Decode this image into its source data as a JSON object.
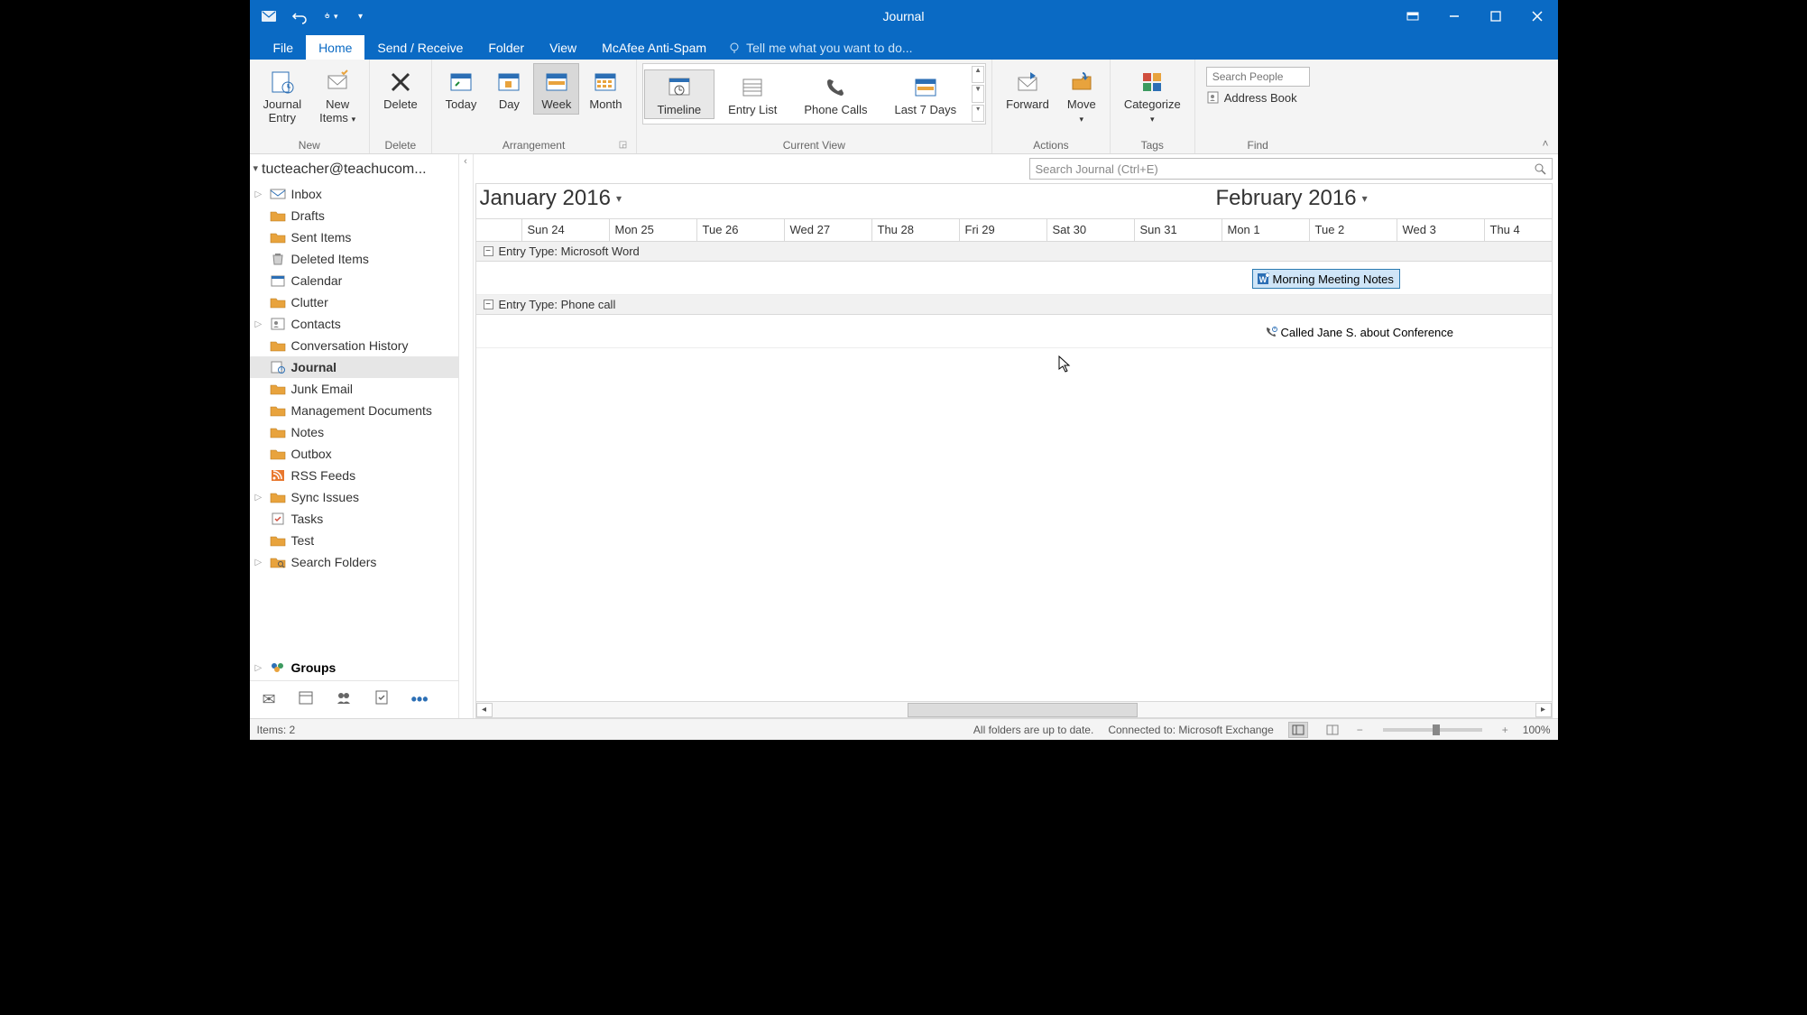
{
  "title": "Journal",
  "tabs": {
    "file": "File",
    "home": "Home",
    "send_receive": "Send / Receive",
    "folder": "Folder",
    "view": "View",
    "mcafee": "McAfee Anti-Spam",
    "tell_me": "Tell me what you want to do..."
  },
  "ribbon": {
    "new": {
      "journal_entry": "Journal\nEntry",
      "new_items": "New\nItems",
      "group_label": "New"
    },
    "delete": {
      "delete": "Delete",
      "group_label": "Delete"
    },
    "arrangement": {
      "today": "Today",
      "day": "Day",
      "week": "Week",
      "month": "Month",
      "group_label": "Arrangement"
    },
    "current_view": {
      "timeline": "Timeline",
      "entry_list": "Entry List",
      "phone_calls": "Phone Calls",
      "last7": "Last 7 Days",
      "group_label": "Current View"
    },
    "actions": {
      "forward": "Forward",
      "move": "Move",
      "group_label": "Actions"
    },
    "tags": {
      "categorize": "Categorize",
      "group_label": "Tags"
    },
    "find": {
      "search_placeholder": "Search People",
      "address_book": "Address Book",
      "group_label": "Find"
    }
  },
  "nav": {
    "account": "tucteacher@teachucom...",
    "folders": [
      {
        "label": "Inbox",
        "expandable": true,
        "icon": "inbox"
      },
      {
        "label": "Drafts",
        "icon": "drafts"
      },
      {
        "label": "Sent Items",
        "icon": "sent"
      },
      {
        "label": "Deleted Items",
        "icon": "trash"
      },
      {
        "label": "Calendar",
        "icon": "calendar"
      },
      {
        "label": "Clutter",
        "icon": "folder"
      },
      {
        "label": "Contacts",
        "expandable": true,
        "icon": "contacts"
      },
      {
        "label": "Conversation History",
        "icon": "folder"
      },
      {
        "label": "Journal",
        "icon": "journal",
        "selected": true
      },
      {
        "label": "Junk Email",
        "icon": "junk"
      },
      {
        "label": "Management Documents",
        "icon": "folder"
      },
      {
        "label": "Notes",
        "icon": "notes"
      },
      {
        "label": "Outbox",
        "icon": "outbox"
      },
      {
        "label": "RSS Feeds",
        "icon": "rss"
      },
      {
        "label": "Sync Issues",
        "expandable": true,
        "icon": "folder"
      },
      {
        "label": "Tasks",
        "icon": "tasks"
      },
      {
        "label": "Test",
        "icon": "folder"
      },
      {
        "label": "Search Folders",
        "expandable": true,
        "icon": "search-folder"
      }
    ],
    "groups": "Groups"
  },
  "search": {
    "placeholder": "Search Journal (Ctrl+E)"
  },
  "timeline": {
    "month1": "January 2016",
    "month2": "February 2016",
    "days": [
      {
        "label": "Sun 24",
        "pos": 50
      },
      {
        "label": "Mon 25",
        "pos": 147
      },
      {
        "label": "Tue 26",
        "pos": 244
      },
      {
        "label": "Wed 27",
        "pos": 341
      },
      {
        "label": "Thu 28",
        "pos": 438
      },
      {
        "label": "Fri 29",
        "pos": 535
      },
      {
        "label": "Sat 30",
        "pos": 632
      },
      {
        "label": "Sun 31",
        "pos": 729
      },
      {
        "label": "Mon 1",
        "pos": 826
      },
      {
        "label": "Tue 2",
        "pos": 923
      },
      {
        "label": "Wed 3",
        "pos": 1020
      },
      {
        "label": "Thu 4",
        "pos": 1117
      }
    ],
    "groups": [
      {
        "header": "Entry Type: Microsoft Word",
        "entries": [
          {
            "label": "Morning Meeting Notes",
            "pos": 860,
            "selected": true,
            "icon": "word"
          }
        ]
      },
      {
        "header": "Entry Type: Phone call",
        "entries": [
          {
            "label": "Called Jane S. about Conference",
            "pos": 870,
            "selected": false,
            "icon": "phone",
            "plain": true
          }
        ]
      }
    ]
  },
  "status": {
    "items": "Items: 2",
    "sync": "All folders are up to date.",
    "connection": "Connected to: Microsoft Exchange",
    "zoom": "100%"
  }
}
